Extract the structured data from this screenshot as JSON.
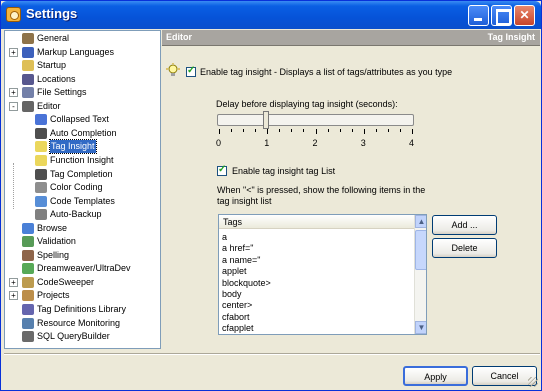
{
  "window": {
    "title": "Settings"
  },
  "tree": [
    {
      "label": "General",
      "icon": "gear-icon",
      "expander": "",
      "level": 0
    },
    {
      "label": "Markup Languages",
      "icon": "code-brackets-icon",
      "expander": "+",
      "level": 0
    },
    {
      "label": "Startup",
      "icon": "folder-icon",
      "expander": "",
      "level": 0
    },
    {
      "label": "Locations",
      "icon": "disk-icon",
      "expander": "",
      "level": 0
    },
    {
      "label": "File Settings",
      "icon": "file-icon",
      "expander": "+",
      "level": 0
    },
    {
      "label": "Editor",
      "icon": "editor-icon",
      "expander": "-",
      "level": 0
    },
    {
      "label": "Collapsed Text",
      "icon": "collapse-icon",
      "expander": "",
      "level": 1
    },
    {
      "label": "Auto Completion",
      "icon": "binoculars-icon",
      "expander": "",
      "level": 1
    },
    {
      "label": "Tag Insight",
      "icon": "lightbulb-icon",
      "expander": "",
      "level": 1,
      "selected": true
    },
    {
      "label": "Function Insight",
      "icon": "lightbulb-icon",
      "expander": "",
      "level": 1
    },
    {
      "label": "Tag Completion",
      "icon": "binoculars-icon",
      "expander": "",
      "level": 1
    },
    {
      "label": "Color Coding",
      "icon": "page-icon",
      "expander": "",
      "level": 1
    },
    {
      "label": "Code Templates",
      "icon": "template-icon",
      "expander": "",
      "level": 1
    },
    {
      "label": "Auto-Backup",
      "icon": "backup-icon",
      "expander": "",
      "level": 1
    },
    {
      "label": "Browse",
      "icon": "browse-icon",
      "expander": "",
      "level": 0
    },
    {
      "label": "Validation",
      "icon": "validation-icon",
      "expander": "",
      "level": 0
    },
    {
      "label": "Spelling",
      "icon": "spelling-icon",
      "expander": "",
      "level": 0
    },
    {
      "label": "Dreamweaver/UltraDev",
      "icon": "dreamweaver-icon",
      "expander": "",
      "level": 0
    },
    {
      "label": "CodeSweeper",
      "icon": "broom-icon",
      "expander": "+",
      "level": 0
    },
    {
      "label": "Projects",
      "icon": "projects-icon",
      "expander": "+",
      "level": 0
    },
    {
      "label": "Tag Definitions Library",
      "icon": "tag-library-icon",
      "expander": "",
      "level": 0
    },
    {
      "label": "Resource Monitoring",
      "icon": "monitor-icon",
      "expander": "",
      "level": 0
    },
    {
      "label": "SQL QueryBuilder",
      "icon": "query-icon",
      "expander": "",
      "level": 0
    }
  ],
  "panel": {
    "section": "Editor",
    "page": "Tag Insight",
    "enable_label": "Enable tag insight - Displays a list of tags/attributes as you type",
    "enable_checked": true,
    "delay_label": "Delay before displaying tag insight (seconds):",
    "delay_value_seconds": 1,
    "slider_ticks": [
      "0",
      "1",
      "2",
      "3",
      "4"
    ],
    "enable_list_label": "Enable tag insight tag List",
    "enable_list_checked": true,
    "list_intro_line1": "When \"<\" is pressed, show the following items in the",
    "list_intro_line2": "tag insight list",
    "list_header": "Tags",
    "list_items": [
      "a",
      "a href=\"",
      "a name=\"",
      "applet",
      "blockquote>",
      "body",
      "center>",
      "cfabort",
      "cfapplet"
    ],
    "add_button": "Add ...",
    "delete_button": "Delete"
  },
  "footer": {
    "apply": "Apply",
    "cancel": "Cancel"
  }
}
